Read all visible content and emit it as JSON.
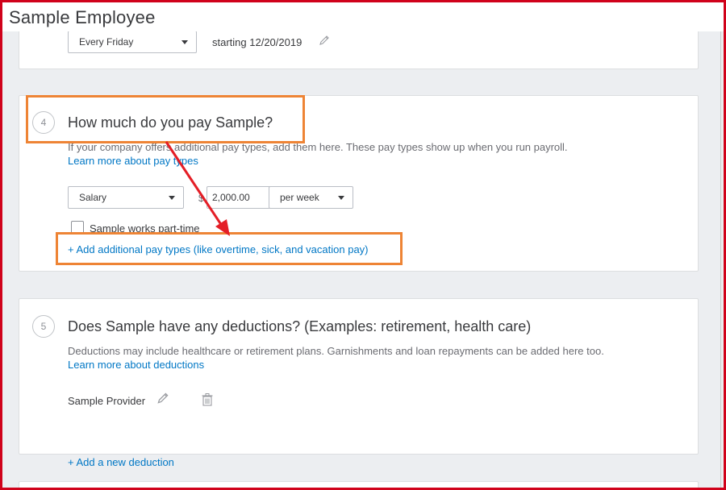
{
  "page": {
    "title": "Sample Employee"
  },
  "pay_schedule": {
    "frequency": "Every Friday",
    "starting": "starting 12/20/2019"
  },
  "section4": {
    "step": "4",
    "title": "How much do you pay Sample?",
    "description": "If your company offers additional pay types, add them here. These pay types show up when you run payroll.",
    "learn_more": "Learn more about pay types",
    "pay_type": "Salary",
    "currency": "$",
    "amount": "2,000.00",
    "period": "per week",
    "part_time_label": "Sample works part-time",
    "part_time_checked": false,
    "add_pay_types": "+ Add additional pay types (like overtime, sick, and vacation pay)"
  },
  "section5": {
    "step": "5",
    "title": "Does Sample have any deductions? (Examples: retirement, health care)",
    "description": "Deductions may include healthcare or retirement plans. Garnishments and loan repayments can be added here too.",
    "learn_more": "Learn more about deductions",
    "provider": "Sample Provider",
    "add_deduction": "+ Add a new deduction"
  },
  "annotations": {
    "highlight_color": "#ee8435",
    "arrow_color": "#e41e26"
  },
  "icons": [
    "pencil-icon",
    "trash-icon",
    "chevron-down-icon"
  ]
}
